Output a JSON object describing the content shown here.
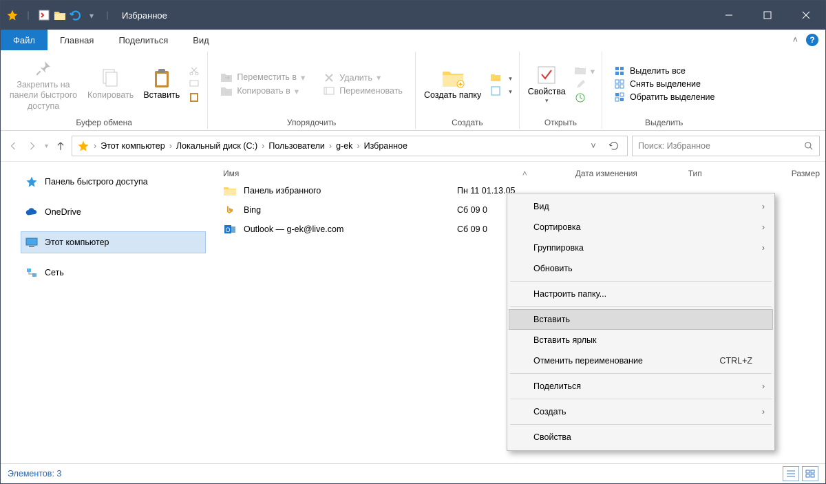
{
  "window": {
    "title": "Избранное"
  },
  "tabs": {
    "file": "Файл",
    "home": "Главная",
    "share": "Поделиться",
    "view": "Вид"
  },
  "ribbon": {
    "clipboard": {
      "label": "Буфер обмена",
      "pin": "Закрепить на панели быстрого доступа",
      "copy": "Копировать",
      "paste": "Вставить",
      "cut": "",
      "copypath": "",
      "pasteshortcut": ""
    },
    "organize": {
      "label": "Упорядочить",
      "move": "Переместить в",
      "copyto": "Копировать в",
      "delete": "Удалить",
      "rename": "Переименовать"
    },
    "new": {
      "label": "Создать",
      "folder": "Создать папку"
    },
    "open": {
      "label": "Открыть",
      "props": "Свойства"
    },
    "select": {
      "label": "Выделить",
      "all": "Выделить все",
      "none": "Снять выделение",
      "invert": "Обратить выделение"
    }
  },
  "breadcrumb": {
    "p0": "Этот компьютер",
    "p1": "Локальный диск (C:)",
    "p2": "Пользователи",
    "p3": "g-ek",
    "p4": "Избранное"
  },
  "search": {
    "placeholder": "Поиск: Избранное"
  },
  "columns": {
    "name": "Имя",
    "date": "Дата изменения",
    "type": "Тип",
    "size": "Размер"
  },
  "sidebar": {
    "quick": "Панель быстрого доступа",
    "onedrive": "OneDrive",
    "pc": "Этот компьютер",
    "net": "Сеть"
  },
  "files": {
    "r0": {
      "name": "Панель избранного",
      "date": "Пн 11 01.13.05"
    },
    "r1": {
      "name": "Bing",
      "date": "Сб 09 0"
    },
    "r2": {
      "name": "Outlook — g-ek@live.com",
      "date": "Сб 09 0"
    }
  },
  "context": {
    "view": "Вид",
    "sort": "Сортировка",
    "group": "Группировка",
    "refresh": "Обновить",
    "customize": "Настроить папку...",
    "paste": "Вставить",
    "pasteshortcut": "Вставить ярлык",
    "undo": "Отменить переименование",
    "undo_key": "CTRL+Z",
    "share": "Поделиться",
    "new": "Создать",
    "props": "Свойства"
  },
  "status": {
    "text": "Элементов: 3"
  }
}
